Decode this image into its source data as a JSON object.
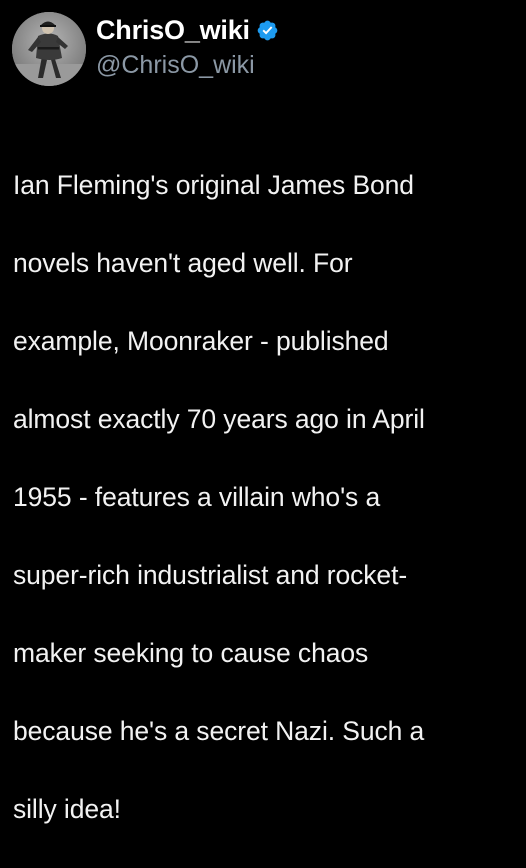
{
  "account": {
    "display_name": "ChrisO_wiki",
    "handle": "@ChrisO_wiki",
    "verified": true,
    "verified_color": "#1d9bf0",
    "avatar_icon": "profile-photo-military-figure"
  },
  "tweet": {
    "text_lines": [
      "Ian Fleming's original James Bond",
      "novels haven't aged well. For",
      "example, Moonraker - published",
      "almost exactly 70 years ago in April",
      "1955 - features a villain who's a",
      "super-rich industrialist and rocket-",
      "maker seeking to cause chaos",
      "because he's a secret Nazi. Such a",
      "silly idea!"
    ]
  },
  "colors": {
    "background": "#000000",
    "text": "#f2f2f2",
    "handle": "#8b98a5"
  }
}
